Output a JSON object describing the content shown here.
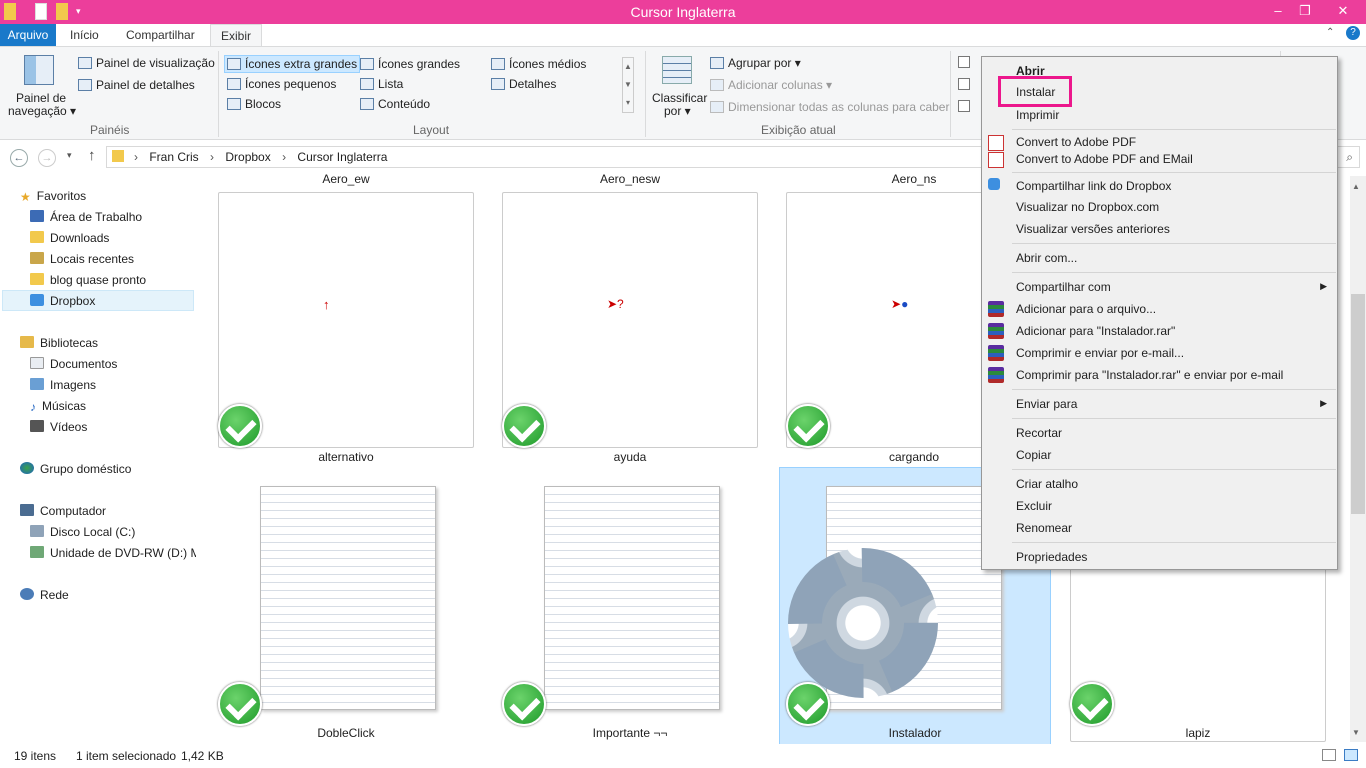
{
  "window": {
    "title": "Cursor Inglaterra",
    "minimize": "–",
    "maximize": "❐",
    "close": "✕"
  },
  "tabs": [
    {
      "label": "Arquivo"
    },
    {
      "label": "Início"
    },
    {
      "label": "Compartilhar"
    },
    {
      "label": "Exibir"
    }
  ],
  "ribbon": {
    "panes": {
      "nav_pane": "Painel de",
      "nav_pane2": "navegação ▾",
      "preview": "Painel de visualização",
      "details": "Painel de detalhes",
      "group": "Painéis"
    },
    "layout": {
      "xl": "Ícones extra grandes",
      "large": "Ícones grandes",
      "medium": "Ícones médios",
      "small": "Ícones pequenos",
      "list": "Lista",
      "details": "Detalhes",
      "tiles": "Blocos",
      "content": "Conteúdo",
      "group": "Layout"
    },
    "current": {
      "sort": "Classificar",
      "sort2": "por ▾",
      "group_by": "Agrupar por ▾",
      "add_cols": "Adicionar colunas ▾",
      "size_cols": "Dimensionar todas as colunas para caber",
      "group": "Exibição atual"
    }
  },
  "address": {
    "crumbs": [
      "Fran Cris",
      "Dropbox",
      "Cursor Inglaterra"
    ]
  },
  "nav": {
    "favorites": "Favoritos",
    "desktop": "Área de Trabalho",
    "downloads": "Downloads",
    "recent": "Locais recentes",
    "blog": "blog quase pronto",
    "dropbox": "Dropbox",
    "libraries": "Bibliotecas",
    "docs": "Documentos",
    "images": "Imagens",
    "music": "Músicas",
    "videos": "Vídeos",
    "homegroup": "Grupo doméstico",
    "computer": "Computador",
    "disk": "Disco Local (C:)",
    "dvd": "Unidade de DVD-RW (D:) M",
    "network": "Rede"
  },
  "files": {
    "top_labels": [
      "Aero_ew",
      "Aero_nesw",
      "Aero_ns"
    ],
    "row1": [
      "alternativo",
      "ayuda",
      "cargando"
    ],
    "row2": [
      "DobleClick",
      "Importante ¬¬",
      "Instalador",
      "lapiz"
    ]
  },
  "status": {
    "count": "19 itens",
    "selection": "1 item selecionado",
    "size": "1,42 KB"
  },
  "menu": {
    "open": "Abrir",
    "install": "Instalar",
    "print": "Imprimir",
    "pdf": "Convert to Adobe PDF",
    "pdf_email": "Convert to Adobe PDF and EMail",
    "db_share": "Compartilhar link do Dropbox",
    "db_view": "Visualizar no Dropbox.com",
    "db_versions": "Visualizar versões anteriores",
    "open_with": "Abrir com...",
    "share_with": "Compartilhar com",
    "add_archive": "Adicionar para o arquivo...",
    "add_rar": "Adicionar para \"Instalador.rar\"",
    "compress_email": "Comprimir e enviar por e-mail...",
    "compress_rar_email": "Comprimir para \"Instalador.rar\" e enviar por e-mail",
    "send_to": "Enviar para",
    "cut": "Recortar",
    "copy": "Copiar",
    "shortcut": "Criar atalho",
    "delete": "Excluir",
    "rename": "Renomear",
    "props": "Propriedades"
  },
  "colors": {
    "titlebar": "#ec3e9b",
    "file_tab": "#1979ca",
    "highlight": "#ec178c",
    "selection": "#cce8ff"
  }
}
